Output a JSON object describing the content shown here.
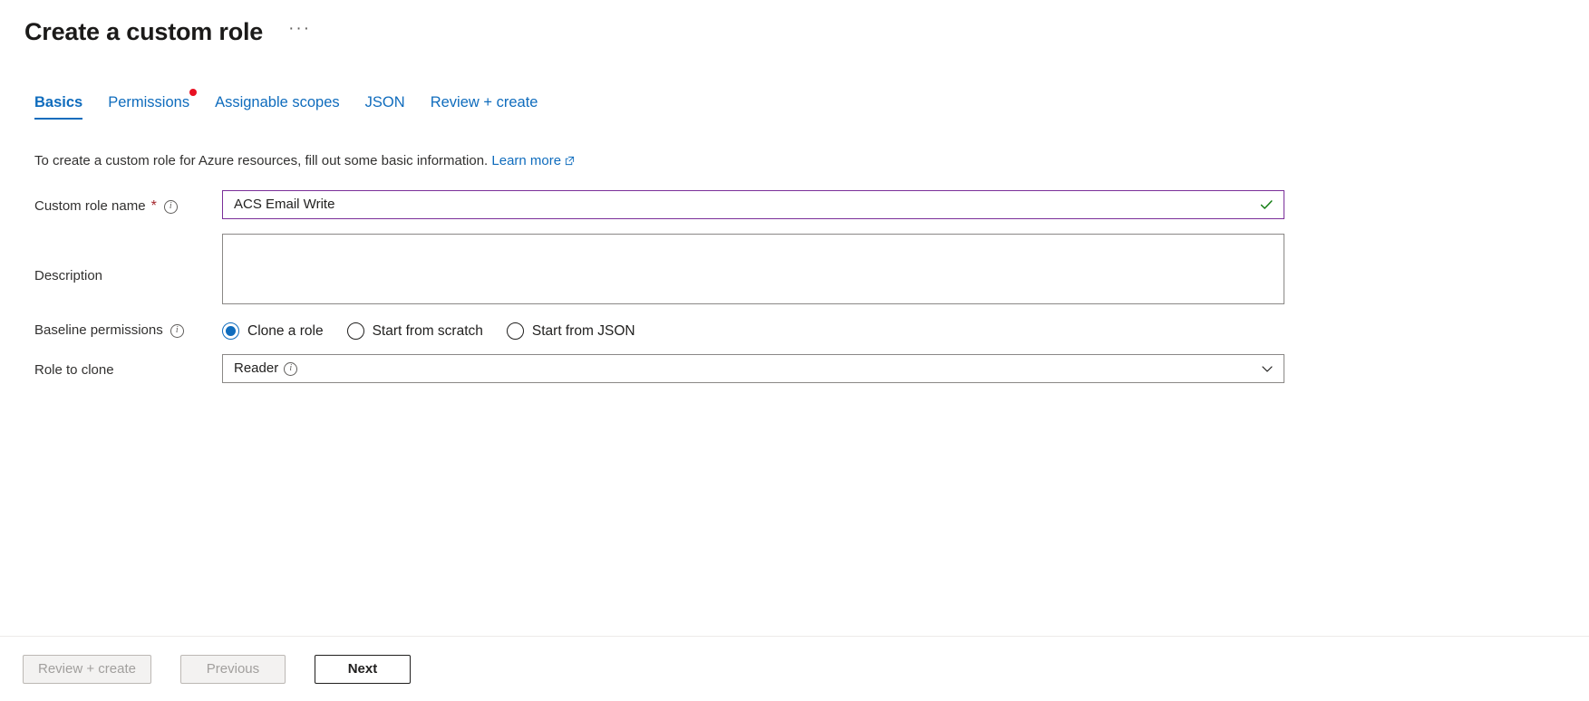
{
  "header": {
    "title": "Create a custom role",
    "more_label": "···"
  },
  "tabs": [
    {
      "label": "Basics",
      "active": true,
      "dot": false
    },
    {
      "label": "Permissions",
      "active": false,
      "dot": true
    },
    {
      "label": "Assignable scopes",
      "active": false,
      "dot": false
    },
    {
      "label": "JSON",
      "active": false,
      "dot": false
    },
    {
      "label": "Review + create",
      "active": false,
      "dot": false
    }
  ],
  "intro": {
    "text": "To create a custom role for Azure resources, fill out some basic information.",
    "link_label": "Learn more",
    "link_icon": "external-link-icon"
  },
  "form": {
    "role_name": {
      "label": "Custom role name",
      "required_marker": "*",
      "info_icon": "info-icon",
      "value": "ACS Email Write",
      "placeholder": "",
      "valid_icon": "check-icon",
      "border_color": "#7a2f99",
      "check_color": "#107c10"
    },
    "description": {
      "label": "Description",
      "value": "",
      "placeholder": ""
    },
    "baseline_permissions": {
      "label": "Baseline permissions",
      "info_icon": "info-icon",
      "options": [
        {
          "label": "Clone a role",
          "checked": true
        },
        {
          "label": "Start from scratch",
          "checked": false
        },
        {
          "label": "Start from JSON",
          "checked": false
        }
      ]
    },
    "role_to_clone": {
      "label": "Role to clone",
      "value": "Reader",
      "info_icon": "info-icon",
      "chevron_icon": "chevron-down-icon"
    }
  },
  "footer": {
    "review_create": "Review + create",
    "previous": "Previous",
    "next": "Next"
  },
  "colors": {
    "accent": "#0f6cbd",
    "required": "#a4262c",
    "dot": "#e81123",
    "valid_border": "#7a2f99",
    "check": "#107c10"
  }
}
